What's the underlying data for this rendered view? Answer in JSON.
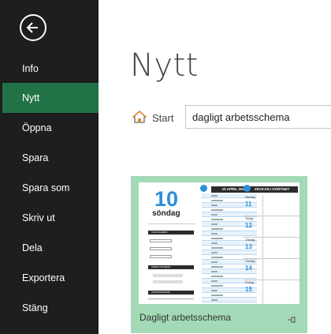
{
  "sidebar": {
    "items": [
      {
        "label": "Info",
        "active": false
      },
      {
        "label": "Nytt",
        "active": true
      },
      {
        "label": "Öppna",
        "active": false
      },
      {
        "label": "Spara",
        "active": false
      },
      {
        "label": "Spara som",
        "active": false
      },
      {
        "label": "Skriv ut",
        "active": false
      },
      {
        "label": "Dela",
        "active": false
      },
      {
        "label": "Exportera",
        "active": false
      },
      {
        "label": "Stäng",
        "active": false
      }
    ],
    "back_icon": "back-arrow-icon",
    "colors": {
      "background": "#1e1e1e",
      "active": "#217346"
    }
  },
  "main": {
    "title": "Nytt",
    "breadcrumb": {
      "start_label": "Start",
      "home_icon": "home-icon"
    },
    "search": {
      "value": "dagligt arbetsschema"
    }
  },
  "templates": [
    {
      "name": "Dagligt arbetsschema",
      "pin_icon": "pin-icon",
      "tile_color": "#a3d9b7",
      "thumbnail": {
        "day_number": "10",
        "day_name": "söndag",
        "date_header": "10 APRIL 2016",
        "week_header": "VECKAN I KORTHET",
        "sidebar_bars": [
          "VISA SCHEMA",
          "ÄNDRA SCHEMA",
          "ANTECKNINGAR"
        ],
        "week_days": [
          {
            "num": "11",
            "name": "Måndag"
          },
          {
            "num": "12",
            "name": "Tisdag"
          },
          {
            "num": "13",
            "name": "Onsdag"
          },
          {
            "num": "14",
            "name": "Torsdag"
          },
          {
            "num": "15",
            "name": "Fredag"
          }
        ]
      }
    }
  ]
}
